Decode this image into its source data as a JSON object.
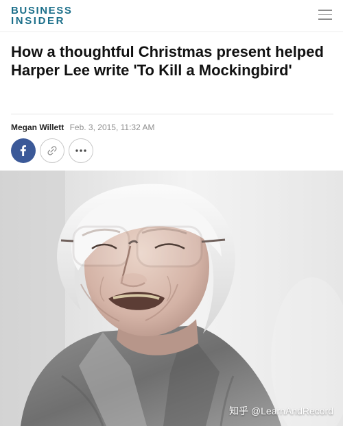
{
  "header": {
    "logo_line_1": "BUSINESS",
    "logo_line_2": "INSIDER",
    "brand_color": "#1b6f8a",
    "menu_icon": "hamburger-menu-icon"
  },
  "article": {
    "headline": "How a thoughtful Christmas present helped Harper Lee write 'To Kill a Mockingbird'",
    "author": "Megan Willett",
    "date": "Feb. 3, 2015, 11:32 AM"
  },
  "share": {
    "facebook_icon": "facebook-icon",
    "facebook_color": "#3b5998",
    "link_icon": "link-icon",
    "more_icon": "more-options-icon"
  },
  "image": {
    "description": "smiling older woman with white hair and glasses",
    "watermark": "知乎 @LearnAndRecord"
  }
}
